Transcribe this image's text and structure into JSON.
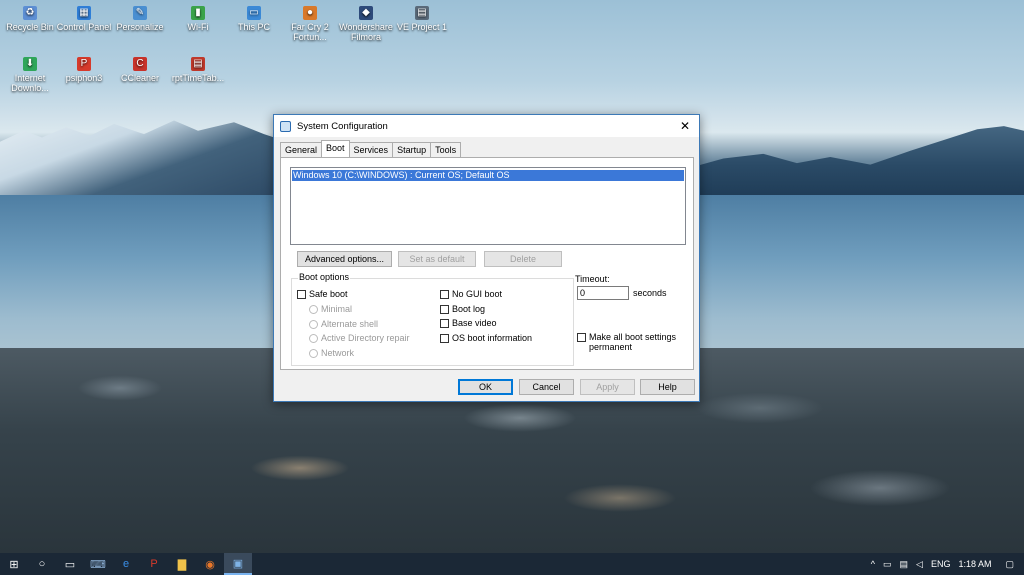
{
  "desktop": {
    "icons": [
      {
        "label": "Recycle Bin",
        "glyph": "♻",
        "color": "#5d8fd4"
      },
      {
        "label": "Control Panel",
        "glyph": "▦",
        "color": "#2f7ed8"
      },
      {
        "label": "Personalize",
        "glyph": "✎",
        "color": "#4a8fd1"
      },
      {
        "label": "Wi-Fi",
        "glyph": "▮",
        "color": "#3aa34a"
      },
      {
        "label": "This PC",
        "glyph": "▭",
        "color": "#3b89d6"
      },
      {
        "label": "Far Cry 2 Fortun...",
        "glyph": "●",
        "color": "#d9792a"
      },
      {
        "label": "Wondershare Filmora",
        "glyph": "◆",
        "color": "#2d4a7a"
      },
      {
        "label": "VE Project 1",
        "glyph": "▤",
        "color": "#5a6a7a"
      },
      {
        "label": "Internet Downlo...",
        "glyph": "⬇",
        "color": "#2fa65a"
      },
      {
        "label": "psiphon3",
        "glyph": "P",
        "color": "#d63a2b"
      },
      {
        "label": "CCleaner",
        "glyph": "C",
        "color": "#c8322a"
      },
      {
        "label": "rptTimeTab...",
        "glyph": "▤",
        "color": "#c0392b"
      }
    ]
  },
  "dialog": {
    "title": "System Configuration",
    "close_glyph": "✕",
    "tabs": [
      "General",
      "Boot",
      "Services",
      "Startup",
      "Tools"
    ],
    "os_entries": [
      "Windows 10 (C:\\WINDOWS) : Current OS; Default OS"
    ],
    "buttons": {
      "advanced": "Advanced options...",
      "set_default": "Set as default",
      "delete": "Delete",
      "ok": "OK",
      "cancel": "Cancel",
      "apply": "Apply",
      "help": "Help"
    },
    "boot_options": {
      "legend": "Boot options",
      "safe_boot": "Safe boot",
      "radios": [
        "Minimal",
        "Alternate shell",
        "Active Directory repair",
        "Network"
      ],
      "checks": [
        "No GUI boot",
        "Boot log",
        "Base video",
        "OS boot information"
      ]
    },
    "timeout": {
      "label": "Timeout:",
      "value": "0",
      "unit": "seconds"
    },
    "make_permanent": "Make all boot settings permanent"
  },
  "taskbar": {
    "items": [
      {
        "name": "windows-start",
        "glyph": "⊞",
        "color": "#ffffff"
      },
      {
        "name": "search",
        "glyph": "○",
        "color": "#ffffff"
      },
      {
        "name": "task-view",
        "glyph": "▭",
        "color": "#ffffff"
      },
      {
        "name": "keyboard",
        "glyph": "⌨",
        "color": "#8fb2d8"
      },
      {
        "name": "edge",
        "glyph": "e",
        "color": "#3a8ee6"
      },
      {
        "name": "psiphon",
        "glyph": "P",
        "color": "#d63a2b"
      },
      {
        "name": "file-explorer",
        "glyph": "▇",
        "color": "#f0c24a"
      },
      {
        "name": "firefox",
        "glyph": "◉",
        "color": "#e8772a"
      },
      {
        "name": "msconfig",
        "glyph": "▣",
        "color": "#7fb3e6"
      }
    ],
    "tray": {
      "chevron": "^",
      "language": "ENG",
      "time": "1:18 AM",
      "notification_glyph": "▢"
    }
  },
  "colors": {
    "accent": "#0078d7",
    "selection": "#3b78d8",
    "taskbar": "#1b2836"
  }
}
